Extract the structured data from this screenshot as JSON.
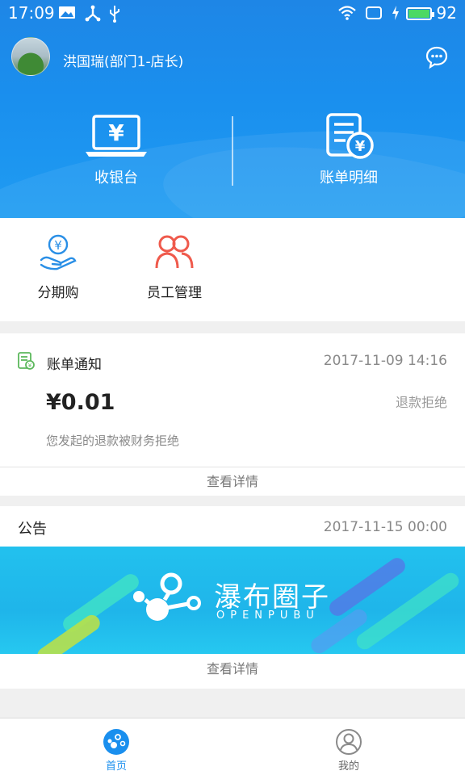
{
  "status_bar": {
    "time": "17:09",
    "battery_percent": "92"
  },
  "user": {
    "name": "洪国瑞(部门1-店长)"
  },
  "header_actions": [
    {
      "label": "收银台",
      "icon": "cashier-laptop-icon"
    },
    {
      "label": "账单明细",
      "icon": "bill-detail-icon"
    }
  ],
  "quick_menu": [
    {
      "label": "分期购",
      "icon": "installment-icon"
    },
    {
      "label": "员工管理",
      "icon": "staff-management-icon"
    }
  ],
  "bill_notice": {
    "title": "账单通知",
    "date": "2017-11-09 14:16",
    "amount": "¥0.01",
    "status": "退款拒绝",
    "description": "您发起的退款被财务拒绝",
    "detail_link": "查看详情"
  },
  "announcement": {
    "title": "公告",
    "date": "2017-11-15 00:00",
    "banner_title": "瀑布圈子",
    "banner_subtitle": "OPENPUBU",
    "detail_link": "查看详情"
  },
  "tabs": [
    {
      "label": "首页",
      "active": true
    },
    {
      "label": "我的",
      "active": false
    }
  ],
  "colors": {
    "primary": "#1a8fee",
    "staff_icon": "#ef5a4c",
    "bill_icon": "#5cb85c"
  }
}
